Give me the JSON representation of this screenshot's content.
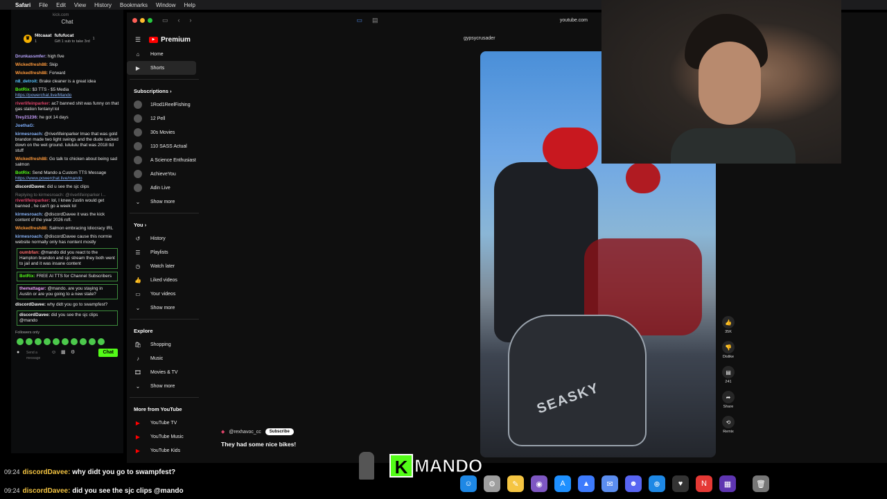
{
  "menubar": {
    "apple": "",
    "items": [
      "Safari",
      "File",
      "Edit",
      "View",
      "History",
      "Bookmarks",
      "Window",
      "Help"
    ]
  },
  "chat": {
    "url": "kick.com",
    "header": "Chat",
    "gift": {
      "sender": "f4tcaaat",
      "badge_count": "1",
      "recipient": "fufufucat",
      "recipient_count": "1",
      "note": "Gift 1 sub to take 3rd"
    },
    "messages": [
      {
        "user": "Drunkassmfer:",
        "color": "#b9a6ff",
        "text": " high five",
        "boxed": false
      },
      {
        "user": "Wickedfresh88:",
        "color": "#ff9a3c",
        "text": " Skip",
        "boxed": false
      },
      {
        "user": "Wickedfresh88:",
        "color": "#ff9a3c",
        "text": " Forward",
        "boxed": false
      },
      {
        "user": "n8_detroit:",
        "color": "#58c4ff",
        "text": " Brake cleaner is a great idea",
        "boxed": false
      },
      {
        "user": "BotRix:",
        "color": "#53fc18",
        "text": " $3 TTS - $5 Media ",
        "link": "https://powerchat.live/Mando",
        "boxed": false
      },
      {
        "user": "riverlifeinparker:",
        "color": "#e0446a",
        "text": " ac7 banned shit was funny on that gas station fentanyl lol",
        "boxed": false
      },
      {
        "user": "Trey21236:",
        "color": "#c9a0ff",
        "text": " he got 14 days",
        "boxed": false
      },
      {
        "user": "JoethaG:",
        "color": "#7fb0ff",
        "text": "",
        "boxed": false
      },
      {
        "user": "kirmesroach:",
        "color": "#8ab4f8",
        "text": " @riverlifeinparker lmao that was gold brandon made two light swings and the dude sacked down on the wet ground. lulululu that was 2018 ttd stuff",
        "boxed": false
      },
      {
        "user": "Wickedfresh88:",
        "color": "#ff9a3c",
        "text": " Go talk to chicken about being sad salmon",
        "boxed": false
      },
      {
        "user": "BotRix:",
        "color": "#53fc18",
        "text": " Send Mando a Custom TTS Message ",
        "link": "https://www.powerchat.live/mando",
        "boxed": false
      },
      {
        "user": "discordDavee:",
        "color": "#ffffff",
        "text": " did u see the sjc clips",
        "boxed": false
      },
      {
        "user": "riverlifeinparker:",
        "color": "#e0446a",
        "reply": "Replying to kirmesroach: @riverlifeinparker l...",
        "text": " lol, I knew Justin would get banned , he can't go a week lol",
        "boxed": false
      },
      {
        "user": "kirmesroach:",
        "color": "#8ab4f8",
        "text": " @discordDavee it was the kick content of the year 2026 rofl.",
        "boxed": false
      },
      {
        "user": "Wickedfresh88:",
        "color": "#ff9a3c",
        "text": " Salmon embracing Idiocracy IRL",
        "boxed": false
      },
      {
        "user": "kirmesroach:",
        "color": "#8ab4f8",
        "text": " @discordDavee cause this normie website normally only has nontent mostly",
        "boxed": false
      },
      {
        "user": "oumbfan:",
        "color": "#ff6e6e",
        "text": " @mando did you react to the Hampton brandon and sjc stream they both went to jail and it was insane content",
        "boxed": true
      },
      {
        "user": "BotRix:",
        "color": "#53fc18",
        "text": " FREE AI TTS for Channel Subscribers",
        "boxed": true
      },
      {
        "user": "themattagar:",
        "color": "#f0a6ff",
        "text": " @mando. are you staying in Austin or are you going to a new state?",
        "boxed": true
      },
      {
        "user": "discordDavee:",
        "color": "#ffffff",
        "text": " why didt you go to swampfest?",
        "boxed": false
      },
      {
        "user": "discordDavee:",
        "color": "#ffffff",
        "text": " did you see the sjc clips @mando",
        "boxed": true
      }
    ],
    "followers_only": "Followers only",
    "input_placeholder": "Send a message",
    "send_label": "Chat"
  },
  "browser": {
    "url": "youtube.com"
  },
  "youtube": {
    "brand": "Premium",
    "nav_main": [
      {
        "label": "Home",
        "icon": "home-icon",
        "glyph": "⌂",
        "selected": false
      },
      {
        "label": "Shorts",
        "icon": "shorts-icon",
        "glyph": "▶",
        "selected": true
      }
    ],
    "subscriptions_header": "Subscriptions",
    "subscriptions": [
      "1Rod1ReelFishing",
      "12 Pell",
      "30s Movies",
      "110 SASS Actual",
      "A Science Enthusiast",
      "AchieveYou",
      "Adin Live"
    ],
    "show_more": "Show more",
    "you_header": "You",
    "you_items": [
      {
        "label": "History",
        "icon": "history-icon",
        "glyph": "↺"
      },
      {
        "label": "Playlists",
        "icon": "playlists-icon",
        "glyph": "☰"
      },
      {
        "label": "Watch later",
        "icon": "watch-later-icon",
        "glyph": "◷"
      },
      {
        "label": "Liked videos",
        "icon": "like-icon",
        "glyph": "👍"
      },
      {
        "label": "Your videos",
        "icon": "your-videos-icon",
        "glyph": "▭"
      }
    ],
    "explore_header": "Explore",
    "explore_items": [
      {
        "label": "Shopping",
        "icon": "shopping-icon",
        "glyph": "🛍"
      },
      {
        "label": "Music",
        "icon": "music-icon",
        "glyph": "♪"
      },
      {
        "label": "Movies & TV",
        "icon": "movies-icon",
        "glyph": "🎞"
      }
    ],
    "more_header": "More from YouTube",
    "more_items": [
      "YouTube TV",
      "YouTube Music",
      "YouTube Kids"
    ],
    "short": {
      "channel_top": "gypsycrusader",
      "overlay_channel": "@rexhavoc_cc",
      "subscribe": "Subscribe",
      "caption": "They had some nice bikes!",
      "like_count": "35K",
      "dislike_label": "Dislike",
      "comment_count": "241",
      "share_label": "Share",
      "remix_label": "Remix",
      "video_text": "SEASKY"
    }
  },
  "overlay": {
    "lines": [
      {
        "time": "09:24",
        "user": "discordDavee:",
        "text": "why didt you go to swampfest?"
      },
      {
        "time": "09:24",
        "user": "discordDavee:",
        "text": "did you see the sjc clips @mando"
      }
    ],
    "logo_letter": "K",
    "logo_name": "MANDO"
  },
  "dock": [
    "finder-icon",
    "launchpad-icon",
    "notes-icon",
    "app-icon",
    "appstore-icon",
    "email-icon",
    "mail-icon",
    "discord-icon",
    "safari-icon",
    "activity-monitor-icon",
    "news-icon",
    "apps-grid-icon",
    "trash-icon"
  ]
}
